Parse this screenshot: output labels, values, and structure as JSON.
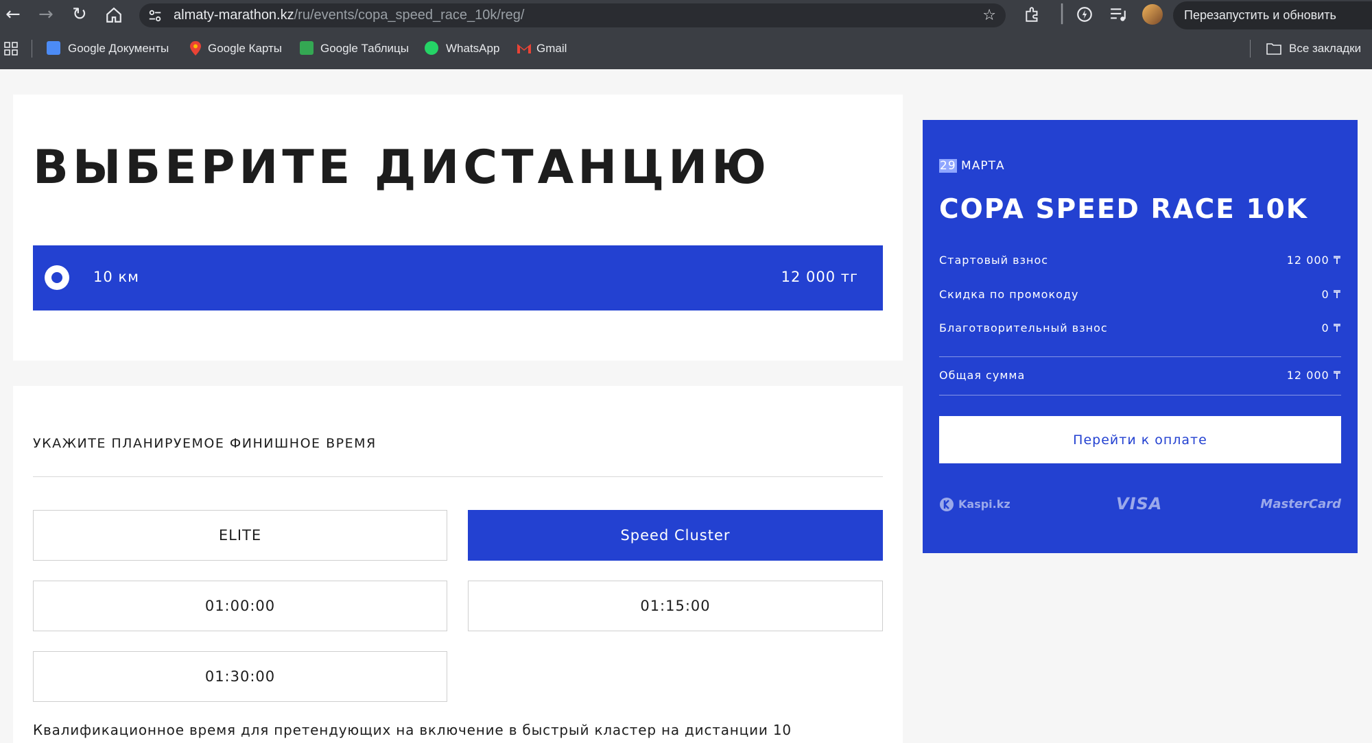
{
  "browser": {
    "url_domain": "almaty-marathon.kz",
    "url_path": "/ru/events/copa_speed_race_10k/reg/",
    "relaunch_label": "Перезапустить и обновить",
    "bookmarks": [
      {
        "label": "Google Документы",
        "icon": "docs-icon",
        "color": "#4c8bf5"
      },
      {
        "label": "Google Карты",
        "icon": "maps-icon",
        "color": "#ea4335"
      },
      {
        "label": "Google Таблицы",
        "icon": "sheets-icon",
        "color": "#34a853"
      },
      {
        "label": "WhatsApp",
        "icon": "whatsapp-icon",
        "color": "#25d366"
      },
      {
        "label": "Gmail",
        "icon": "gmail-icon",
        "color": "#ea4335"
      }
    ],
    "all_bookmarks_label": "Все закладки"
  },
  "main": {
    "heading": "ВЫБЕРИТЕ ДИСТАНЦИЮ",
    "distance": {
      "label": "10 км",
      "price": "12 000 тг",
      "selected": true
    },
    "finish_title": "УКАЖИТЕ ПЛАНИРУЕМОЕ ФИНИШНОЕ ВРЕМЯ",
    "options": [
      {
        "label": "ELITE",
        "selected": false
      },
      {
        "label": "Speed Cluster",
        "selected": true
      },
      {
        "label": "01:00:00",
        "selected": false
      },
      {
        "label": "01:15:00",
        "selected": false
      },
      {
        "label": "01:30:00",
        "selected": false
      }
    ],
    "qualification_note": "Квалификационное время для претендующих на включение в быстрый кластер на дистанции 10"
  },
  "summary": {
    "date_day": "29",
    "date_month": "МАРТА",
    "event_title": "COPA SPEED RACE 10K",
    "rows": [
      {
        "label": "Стартовый взнос",
        "value": "12 000 ₸"
      },
      {
        "label": "Скидка по промокоду",
        "value": "0 ₸"
      },
      {
        "label": "Благотворительный взнос",
        "value": "0 ₸"
      }
    ],
    "total_label": "Общая сумма",
    "total_value": "12 000 ₸",
    "pay_button": "Перейти к оплате",
    "payment_logos": [
      "Kaspi.kz",
      "VISA",
      "MasterCard"
    ]
  },
  "colors": {
    "accent": "#2341d1",
    "chrome": "#3b3e44"
  }
}
